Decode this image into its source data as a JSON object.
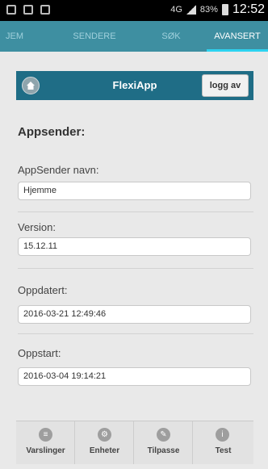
{
  "status_bar": {
    "network": "4G",
    "battery": "83%",
    "time": "12:52"
  },
  "tabs": [
    {
      "label": "JEM",
      "active": false
    },
    {
      "label": "SENDERE",
      "active": false
    },
    {
      "label": "SØK",
      "active": false
    },
    {
      "label": "AVANSERT",
      "active": true
    }
  ],
  "header": {
    "title": "FlexiApp",
    "logout_label": "logg av",
    "home_icon": "home-icon"
  },
  "section_title": "Appsender:",
  "fields": [
    {
      "label": "AppSender navn:",
      "value": "Hjemme"
    },
    {
      "label": "Version:",
      "value": "15.12.11"
    },
    {
      "label": "Oppdatert:",
      "value": "2016-03-21 12:49:46"
    },
    {
      "label": "Oppstart:",
      "value": "2016-03-04 19:14:21"
    }
  ],
  "bottom_nav": [
    {
      "label": "Varslinger",
      "icon": "list-icon"
    },
    {
      "label": "Enheter",
      "icon": "gear-icon"
    },
    {
      "label": "Tilpasse",
      "icon": "pencil-icon"
    },
    {
      "label": "Test",
      "icon": "info-icon"
    }
  ],
  "colors": {
    "tabbar": "#3e8fa1",
    "header": "#1f6d86",
    "active_indicator": "#2dd3f0"
  }
}
